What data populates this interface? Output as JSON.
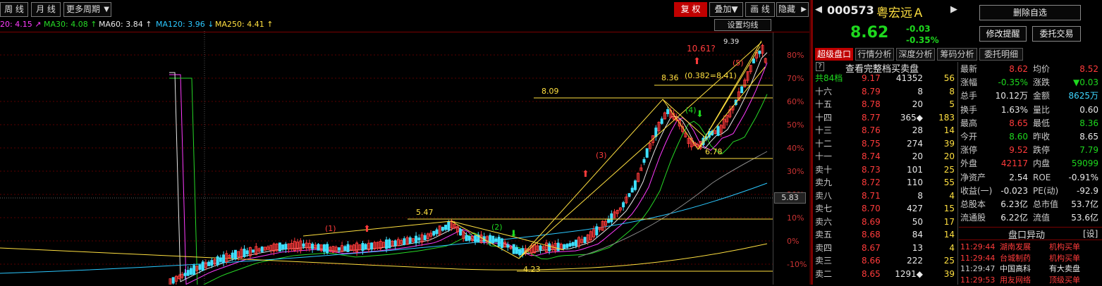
{
  "toolbar": {
    "week": "周 线",
    "month": "月 线",
    "more": "更多周期",
    "more_arrow": "▼",
    "restore": "复 权",
    "overlay": "叠加▼",
    "draw": "画 线",
    "hide": "隐藏",
    "hide_arrow": "▶"
  },
  "ma": {
    "ma20": "20: 4.15 ↗",
    "ma30": "MA30: 4.08 ↑",
    "ma60": "MA60: 3.84 ↑",
    "ma120": "MA120: 3.96 ↓",
    "ma250": "MA250: 4.41 ↑",
    "settings": "设置均线",
    "colors": {
      "ma20": "#ff3bff",
      "ma30": "#26d926",
      "ma60": "#e8e8e8",
      "ma120": "#2bc8ff",
      "ma250": "#ffe040"
    }
  },
  "axis": {
    "pct": [
      "80%",
      "70%",
      "60%",
      "50%",
      "40%",
      "30%",
      "20%",
      "10%",
      "0%",
      "-10%"
    ],
    "cursor_price": "5.83"
  },
  "annotations": {
    "wave1": "(1)",
    "wave2": "(2)",
    "wave3": "(3)",
    "wave4": "(4)",
    "wave5": "(5)",
    "p547": "5.47",
    "p423": "4.23",
    "p809": "8.09",
    "p836": "8.36",
    "fib": "(0.382=8.41)",
    "p678": "6.78",
    "p939": "9.39",
    "target": "10.61?"
  },
  "quote": {
    "back": "◀",
    "code": "000573",
    "name": "粤宏远Ａ",
    "forward": "▶",
    "price": "8.62",
    "change": "-0.03",
    "change_pct": "-0.35%",
    "btn_delete": "删除自选",
    "btn_alert": "修改提醒",
    "btn_trade": "委托交易"
  },
  "tabs": [
    "超级盘口",
    "行情分析",
    "深度分析",
    "筹码分析",
    "委托明细"
  ],
  "orderbook": {
    "help": "?",
    "title": "查看完整档买卖盘",
    "rows": [
      {
        "label": "共84档",
        "price": "9.17",
        "vol": "41352",
        "cnt": "56"
      },
      {
        "label": "十六",
        "price": "8.79",
        "vol": "8",
        "cnt": "8"
      },
      {
        "label": "十五",
        "price": "8.78",
        "vol": "20",
        "cnt": "5"
      },
      {
        "label": "十四",
        "price": "8.77",
        "vol": "365◆",
        "cnt": "183"
      },
      {
        "label": "十三",
        "price": "8.76",
        "vol": "28",
        "cnt": "14"
      },
      {
        "label": "十二",
        "price": "8.75",
        "vol": "274",
        "cnt": "39"
      },
      {
        "label": "十一",
        "price": "8.74",
        "vol": "20",
        "cnt": "20"
      },
      {
        "label": "卖十",
        "price": "8.73",
        "vol": "101",
        "cnt": "25"
      },
      {
        "label": "卖九",
        "price": "8.72",
        "vol": "110",
        "cnt": "55"
      },
      {
        "label": "卖八",
        "price": "8.71",
        "vol": "8",
        "cnt": "4"
      },
      {
        "label": "卖七",
        "price": "8.70",
        "vol": "427",
        "cnt": "15"
      },
      {
        "label": "卖六",
        "price": "8.69",
        "vol": "50",
        "cnt": "17"
      },
      {
        "label": "卖五",
        "price": "8.68",
        "vol": "84",
        "cnt": "14"
      },
      {
        "label": "卖四",
        "price": "8.67",
        "vol": "13",
        "cnt": "4"
      },
      {
        "label": "卖三",
        "price": "8.66",
        "vol": "222",
        "cnt": "25"
      },
      {
        "label": "卖二",
        "price": "8.65",
        "vol": "1291◆",
        "cnt": "39"
      }
    ]
  },
  "stats": [
    {
      "k1": "最新",
      "v1": "8.62",
      "c1": "red",
      "k2": "均价",
      "v2": "8.52",
      "c2": "red"
    },
    {
      "k1": "涨幅",
      "v1": "-0.35%",
      "c1": "green",
      "k2": "涨跌",
      "v2": "▼0.03",
      "c2": "green"
    },
    {
      "k1": "总手",
      "v1": "10.12万",
      "c1": "white",
      "k2": "金额",
      "v2": "8625万",
      "c2": "cyan"
    },
    {
      "k1": "换手",
      "v1": "1.63%",
      "c1": "white",
      "k2": "量比",
      "v2": "0.60",
      "c2": "white"
    },
    {
      "k1": "最高",
      "v1": "8.65",
      "c1": "red",
      "k2": "最低",
      "v2": "8.36",
      "c2": "green"
    },
    {
      "k1": "今开",
      "v1": "8.60",
      "c1": "green",
      "k2": "昨收",
      "v2": "8.65",
      "c2": "white"
    },
    {
      "k1": "涨停",
      "v1": "9.52",
      "c1": "red",
      "k2": "跌停",
      "v2": "7.79",
      "c2": "green"
    },
    {
      "k1": "外盘",
      "v1": "42117",
      "c1": "red",
      "k2": "内盘",
      "v2": "59099",
      "c2": "green"
    },
    {
      "k1": "净资产",
      "v1": "2.54",
      "c1": "white",
      "k2": "ROE",
      "v2": "-0.91%",
      "c2": "white"
    },
    {
      "k1": "收益(一)",
      "v1": "-0.023",
      "c1": "white",
      "k2": "PE(动)",
      "v2": "-92.9",
      "c2": "white"
    },
    {
      "k1": "总股本",
      "v1": "6.23亿",
      "c1": "white",
      "k2": "总市值",
      "v2": "53.7亿",
      "c2": "white"
    },
    {
      "k1": "流通股",
      "v1": "6.22亿",
      "c1": "white",
      "k2": "流值",
      "v2": "53.6亿",
      "c2": "white"
    }
  ],
  "events": {
    "title": "盘口异动",
    "settings": "[设]",
    "rows": [
      {
        "time": "11:29:44",
        "name": "湖南发展",
        "type": "机构买单",
        "color": "red"
      },
      {
        "time": "11:29:44",
        "name": "台城制药",
        "type": "机构买单",
        "color": "red"
      },
      {
        "time": "11:29:47",
        "name": "中国高科",
        "type": "有大卖盘",
        "color": "white"
      },
      {
        "time": "11:29:53",
        "name": "用友网络",
        "type": "顶级买单",
        "color": "red"
      }
    ]
  }
}
